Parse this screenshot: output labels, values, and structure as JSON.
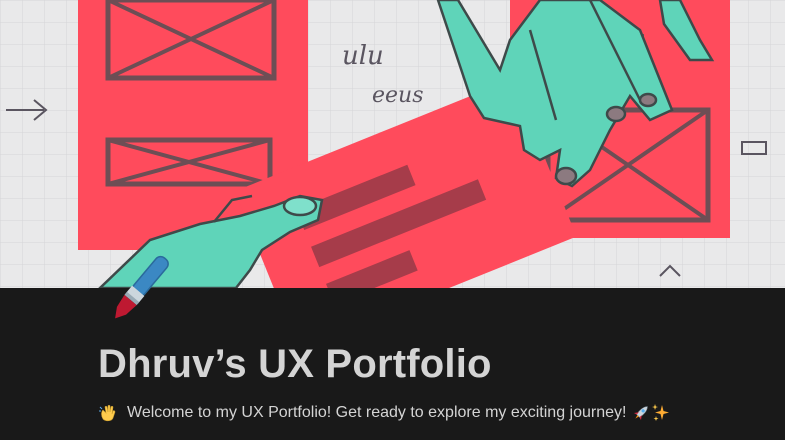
{
  "cover": {
    "image_name": "cover-illustration-hands-with-wireframe-cards",
    "scribble_text_1": "ulu",
    "scribble_text_2": "eeus",
    "colors": {
      "background": "#e9e9ea",
      "card_red": "#ff4b5c",
      "hand_teal": "#5fd4b9",
      "line_dark": "#5a4a52"
    }
  },
  "page": {
    "icon": "paintbrush-icon",
    "title": "Dhruv’s UX Portfolio",
    "subtitle_lead_icon": "waving-hand-icon",
    "subtitle": "Welcome to my UX Portfolio! Get ready to explore my exciting journey!",
    "subtitle_trail_icons": [
      "rocket-icon",
      "sparkles-icon"
    ]
  },
  "theme": {
    "page_background": "#191919",
    "text_color": "#d4d4d4"
  }
}
